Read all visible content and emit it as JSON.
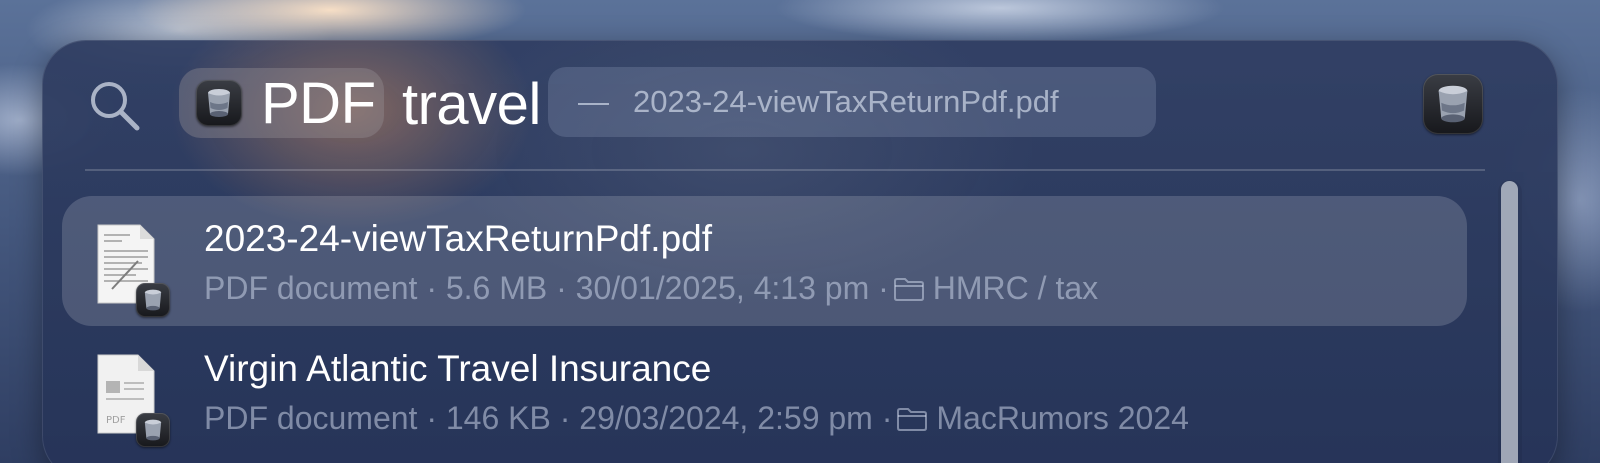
{
  "search": {
    "token_label": "PDF",
    "query": "travel",
    "suggestion_dash": "—",
    "suggestion_text": "2023-24-viewTaxReturnPdf.pdf"
  },
  "results": [
    {
      "title": "2023-24-viewTaxReturnPdf.pdf",
      "kind": "PDF document",
      "size": "5.6 MB",
      "date": "30/01/2025, 4:13 pm",
      "folder": "HMRC / tax",
      "selected": true
    },
    {
      "title": "Virgin Atlantic Travel Insurance",
      "kind": "PDF document",
      "size": "146 KB",
      "date": "29/03/2024, 2:59 pm",
      "folder": "MacRumors 2024",
      "selected": false
    }
  ],
  "separator": "·",
  "doc_icon_label": "PDF",
  "icons": {
    "search": "search-icon",
    "token_app": "preview-app-icon",
    "right_app": "preview-app-icon",
    "folder": "folder-icon",
    "doc": "pdf-document-icon"
  },
  "colors": {
    "panel": "#2f3e62",
    "selection": "#56627c",
    "text_primary": "#ffffff",
    "text_secondary": "#9aa6bd"
  }
}
